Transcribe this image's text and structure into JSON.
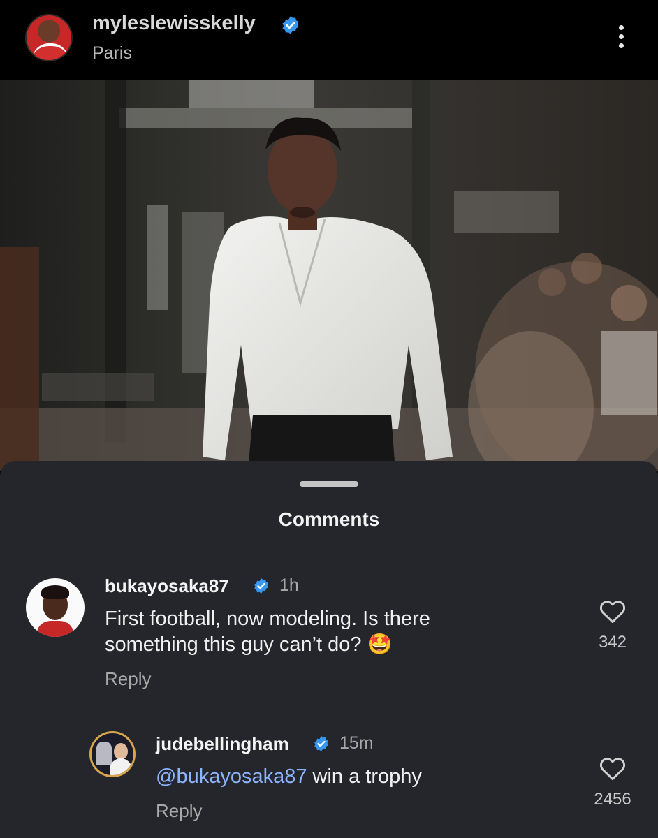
{
  "header": {
    "username": "myleslewisskelly",
    "location": "Paris"
  },
  "comments_sheet": {
    "title": "Comments",
    "comments": [
      {
        "username": "bukayosaka87",
        "time": "1h",
        "text": "First football, now modeling. Is there something this guy can’t do?",
        "emoji": "🤩",
        "reply_label": "Reply",
        "likes": "342"
      },
      {
        "username": "judebellingham",
        "time": "15m",
        "mention": "@bukayosaka87",
        "text": " win a trophy",
        "reply_label": "Reply",
        "likes": "2456"
      }
    ]
  },
  "colors": {
    "verified_blue": "#3897f0",
    "mention_blue": "#8db4ff",
    "sheet_bg": "#24262b"
  }
}
